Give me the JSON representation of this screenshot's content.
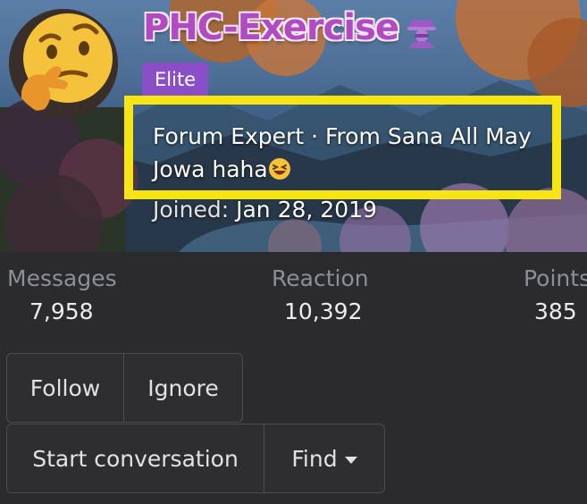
{
  "profile": {
    "username": "PHC-Exercise",
    "badge": "Elite",
    "title_line": "Forum Expert · From Sana All May Jowa haha",
    "joined_label": "Joined:",
    "joined_date": "Jan 28, 2019"
  },
  "stats": {
    "messages_label": "Messages",
    "messages_value": "7,958",
    "reaction_label": "Reaction",
    "reaction_value": "10,392",
    "points_label": "Points",
    "points_value": "385"
  },
  "actions": {
    "follow": "Follow",
    "ignore": "Ignore",
    "start_conversation": "Start conversation",
    "find": "Find"
  },
  "icons": {
    "avatar": "thinking-face-emoji",
    "username_icon": "detective-icon",
    "title_emoji": "laughing-emoji",
    "find_caret": "caret-down-icon"
  },
  "colors": {
    "highlight": "#f7e413",
    "badge": "#8a4ec7",
    "username": "#b04cc0",
    "background": "#2b2b2d"
  }
}
